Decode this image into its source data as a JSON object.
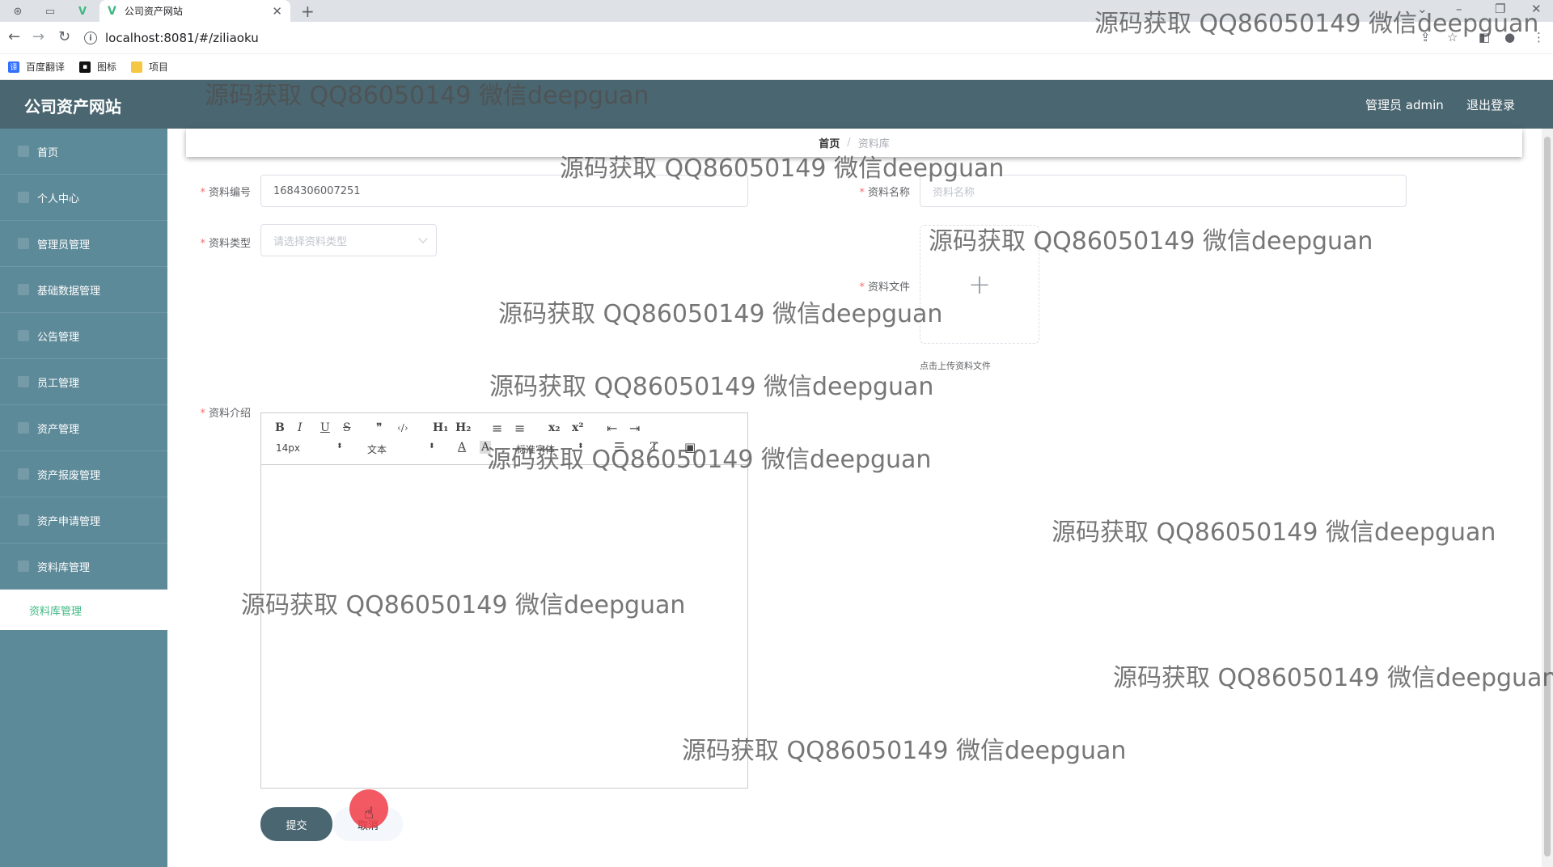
{
  "browser": {
    "tab_title": "公司资产网站",
    "url": "localhost:8081/#/ziliaoku",
    "bookmarks": [
      "百度翻译",
      "图标",
      "项目"
    ]
  },
  "header": {
    "title": "公司资产网站",
    "user": "管理员 admin",
    "logout": "退出登录"
  },
  "sidebar": {
    "items": [
      "首页",
      "个人中心",
      "管理员管理",
      "基础数据管理",
      "公告管理",
      "员工管理",
      "资产管理",
      "资产报废管理",
      "资产申请管理",
      "资料库管理"
    ],
    "active_sub": "资料库管理"
  },
  "breadcrumb": {
    "home": "首页",
    "sep": "/",
    "current": "资料库"
  },
  "form": {
    "code_label": "资料编号",
    "code_value": "1684306007251",
    "name_label": "资料名称",
    "name_placeholder": "资料名称",
    "type_label": "资料类型",
    "type_placeholder": "请选择资料类型",
    "file_label": "资料文件",
    "upload_plus": "+",
    "upload_tip": "点击上传资料文件",
    "intro_label": "资料介绍",
    "required_mark": "*"
  },
  "editor": {
    "font_size": "14px",
    "paragraph": "文本",
    "font_family": "标准字体",
    "buttons": {
      "bold": "B",
      "italic": "I",
      "underline": "U",
      "strike": "S",
      "quote": "❞",
      "code": "‹/›",
      "h1": "H₁",
      "h2": "H₂",
      "ol": "≡",
      "ul": "≡",
      "sub": "x₂",
      "sup": "x²",
      "outdent": "⇤",
      "indent": "⇥",
      "color": "A",
      "background": "A",
      "align": "☰",
      "clean": "T̸",
      "image": "▣"
    }
  },
  "actions": {
    "submit": "提交",
    "cancel": "取消"
  },
  "watermark": "源码获取 QQ86050149 微信deepguan"
}
